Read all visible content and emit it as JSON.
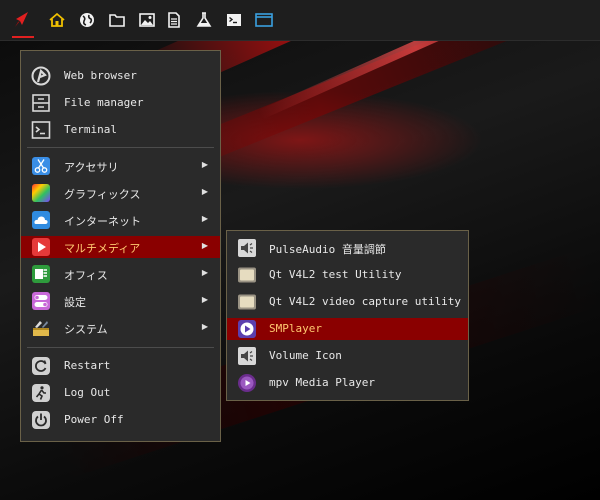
{
  "panel": {
    "buttons": [
      {
        "icon": "home-icon"
      },
      {
        "icon": "globe-icon"
      },
      {
        "icon": "folder-icon"
      },
      {
        "icon": "image-icon"
      },
      {
        "icon": "document-icon"
      },
      {
        "icon": "flask-icon"
      },
      {
        "icon": "terminal-icon"
      },
      {
        "icon": "window-icon"
      }
    ],
    "accent": "#e12020"
  },
  "menu": {
    "quick": [
      {
        "label": "Web browser",
        "icon": "browser-icon"
      },
      {
        "label": "File manager",
        "icon": "file-cabinet-icon"
      },
      {
        "label": "Terminal",
        "icon": "terminal-icon"
      }
    ],
    "categories": [
      {
        "label": "アクセサリ",
        "icon": "scissors-icon"
      },
      {
        "label": "グラフィックス",
        "icon": "palette-icon"
      },
      {
        "label": "インターネット",
        "icon": "cloud-icon"
      },
      {
        "label": "マルチメディア",
        "icon": "play-icon",
        "active": true
      },
      {
        "label": "オフィス",
        "icon": "office-icon"
      },
      {
        "label": "設定",
        "icon": "settings-toggle-icon"
      },
      {
        "label": "システム",
        "icon": "system-tools-icon"
      }
    ],
    "session": [
      {
        "label": "Restart",
        "icon": "restart-icon"
      },
      {
        "label": "Log Out",
        "icon": "logout-icon"
      },
      {
        "label": "Power Off",
        "icon": "power-icon"
      }
    ],
    "arrow": "▶"
  },
  "submenu": {
    "items": [
      {
        "label": "PulseAudio 音量調節",
        "icon": "speaker-icon"
      },
      {
        "label": "Qt V4L2 test Utility",
        "icon": "tv-icon"
      },
      {
        "label": "Qt V4L2 video capture utility",
        "icon": "tv-icon"
      },
      {
        "label": "SMPlayer",
        "icon": "smplayer-icon",
        "active": true
      },
      {
        "label": "Volume Icon",
        "icon": "speaker-icon"
      },
      {
        "label": "mpv Media Player",
        "icon": "mpv-icon"
      }
    ]
  },
  "colors": {
    "active_bg": "#8a0000",
    "active_text": "#ffc870",
    "menu_border": "#6a6148"
  }
}
